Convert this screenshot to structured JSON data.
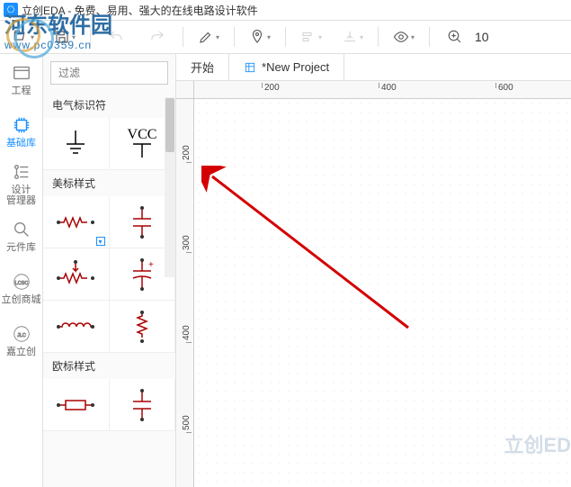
{
  "app": {
    "title": "立创EDA - 免费、易用、强大的在线电路设计软件"
  },
  "watermark": {
    "text": "河东软件园",
    "url": "www.pc0359.cn",
    "right": "立创ED"
  },
  "toolbar": {
    "zoom_value": "10"
  },
  "rail": {
    "project": "工程",
    "basiclib": "基础库",
    "design": "设计\n管理器",
    "partlib": "元件库",
    "lcscmall": "立创商城",
    "jlc": "嘉立创"
  },
  "lib": {
    "filter_placeholder": "过滤",
    "sections": {
      "electrical": "电气标识符",
      "us_style": "美标样式",
      "eu_style": "欧标样式"
    },
    "vcc_label": "VCC"
  },
  "tabs": {
    "start": "开始",
    "new_project": "*New Project"
  },
  "ruler": {
    "h": [
      "200",
      "400",
      "600"
    ],
    "v": [
      "200",
      "300",
      "400",
      "500"
    ]
  }
}
